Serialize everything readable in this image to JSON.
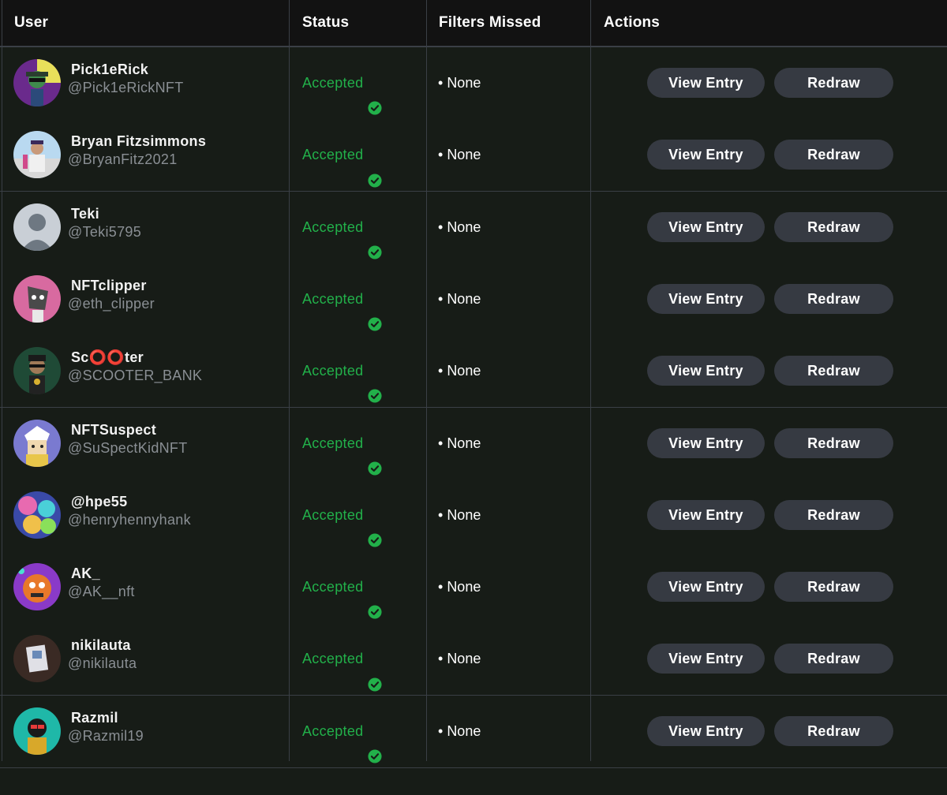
{
  "headers": {
    "user": "User",
    "status": "Status",
    "filters_missed": "Filters Missed",
    "actions": "Actions"
  },
  "colors": {
    "background": "#171c17",
    "header_background": "#121212",
    "accepted": "#22b04a",
    "button": "#363a42",
    "handle": "#8a8f94"
  },
  "rows": [
    {
      "name": "Pick1eRick",
      "handle": "@Pick1eRickNFT",
      "status": "Accepted",
      "filters_missed": "None",
      "view_label": "View Entry",
      "redraw_label": "Redraw",
      "avatar": "avatar-green-character"
    },
    {
      "name": "Bryan Fitzsimmons",
      "handle": "@BryanFitz2021",
      "status": "Accepted",
      "filters_missed": "None",
      "view_label": "View Entry",
      "redraw_label": "Redraw",
      "avatar": "avatar-person-photo"
    },
    {
      "name": "Teki",
      "handle": "@Teki5795",
      "status": "Accepted",
      "filters_missed": "None",
      "view_label": "View Entry",
      "redraw_label": "Redraw",
      "avatar": "avatar-default-placeholder"
    },
    {
      "name": "NFTclipper",
      "handle": "@eth_clipper",
      "status": "Accepted",
      "filters_missed": "None",
      "view_label": "View Entry",
      "redraw_label": "Redraw",
      "avatar": "avatar-pink-character"
    },
    {
      "name": "Sc⭕⭕ter",
      "handle": "@SCOOTER_BANK",
      "status": "Accepted",
      "filters_missed": "None",
      "view_label": "View Entry",
      "redraw_label": "Redraw",
      "avatar": "avatar-dark-green-character"
    },
    {
      "name": "NFTSuspect",
      "handle": "@SuSpectKidNFT",
      "status": "Accepted",
      "filters_missed": "None",
      "view_label": "View Entry",
      "redraw_label": "Redraw",
      "avatar": "avatar-cartoon-kid"
    },
    {
      "name": "@hpe55",
      "handle": "@henryhennyhank",
      "status": "Accepted",
      "filters_missed": "None",
      "view_label": "View Entry",
      "redraw_label": "Redraw",
      "avatar": "avatar-colorful-abstract"
    },
    {
      "name": "AK_",
      "handle": "@AK__nft",
      "status": "Accepted",
      "filters_missed": "None",
      "view_label": "View Entry",
      "redraw_label": "Redraw",
      "avatar": "avatar-orange-monster"
    },
    {
      "name": "nikilauta",
      "handle": "@nikilauta",
      "status": "Accepted",
      "filters_missed": "None",
      "view_label": "View Entry",
      "redraw_label": "Redraw",
      "avatar": "avatar-device-photo"
    },
    {
      "name": "Razmil",
      "handle": "@Razmil19",
      "status": "Accepted",
      "filters_missed": "None",
      "view_label": "View Entry",
      "redraw_label": "Redraw",
      "avatar": "avatar-teal-character"
    }
  ]
}
